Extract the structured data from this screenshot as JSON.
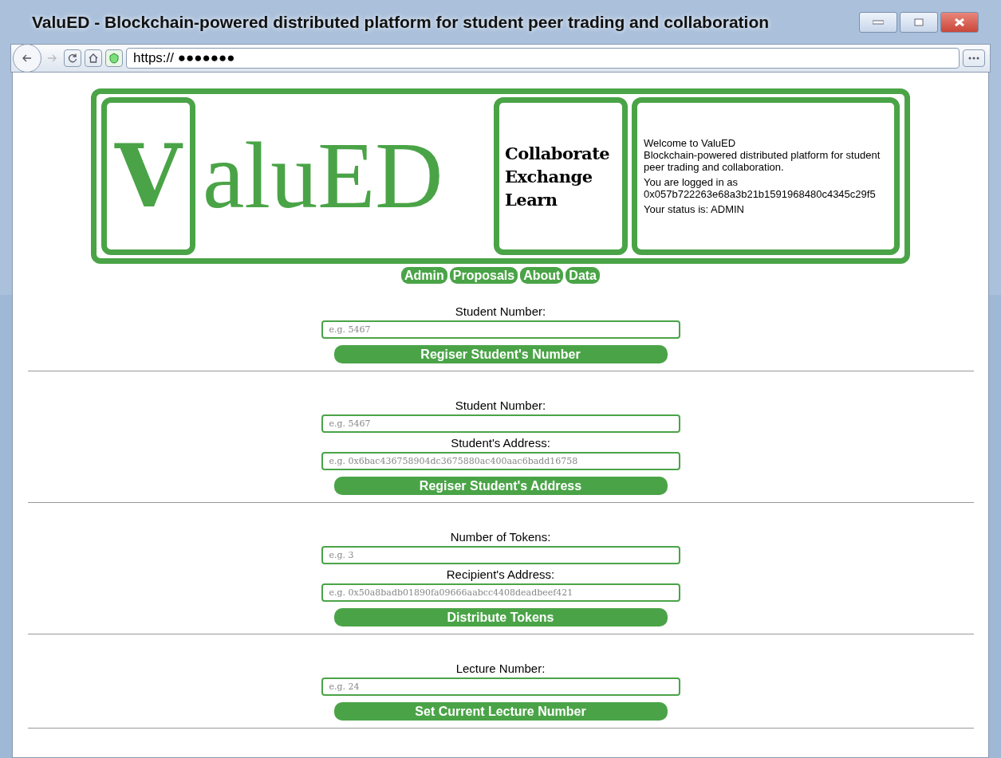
{
  "window": {
    "title": "ValuED - Blockchain-powered distributed platform for student peer trading and collaboration"
  },
  "toolbar": [
    {
      "kind": "back",
      "disabled": false
    },
    {
      "kind": "forward",
      "disabled": true
    },
    {
      "kind": "reload",
      "disabled": false
    },
    {
      "kind": "home",
      "disabled": false
    }
  ],
  "address_bar": {
    "value": "https:// ●●●●●●●"
  },
  "logo": {
    "initial": "V",
    "rest": "aluED"
  },
  "tagline": [
    "Collaborate",
    "Exchange",
    "Learn"
  ],
  "welcome": {
    "title": "Welcome to ValuED",
    "description": "Blockchain-powered distributed platform for student peer trading and collaboration.",
    "login": "You are logged in as 0x057b722263e68a3b21b1591968480c4345c29f5",
    "status": "Your status is: ADMIN"
  },
  "nav": [
    "Admin",
    "Proposals",
    "About",
    "Data"
  ],
  "sections": [
    {
      "fields": [
        {
          "label": "Student Number:",
          "placeholder": "e.g. 5467"
        }
      ],
      "button": "Regiser Student's Number"
    },
    {
      "fields": [
        {
          "label": "Student Number:",
          "placeholder": "e.g. 5467"
        },
        {
          "label": "Student's Address:",
          "placeholder": "e.g. 0x6bac436758904dc3675880ac400aac6badd16758"
        }
      ],
      "button": "Regiser Student's Address"
    },
    {
      "fields": [
        {
          "label": "Number of Tokens:",
          "placeholder": "e.g. 3"
        },
        {
          "label": "Recipient's Address:",
          "placeholder": "e.g. 0x50a8badb01890fa09666aabcc4408deadbeef421"
        }
      ],
      "button": "Distribute Tokens"
    },
    {
      "fields": [
        {
          "label": "Lecture Number:",
          "placeholder": "e.g. 24"
        }
      ],
      "button": "Set Current Lecture Number"
    }
  ]
}
